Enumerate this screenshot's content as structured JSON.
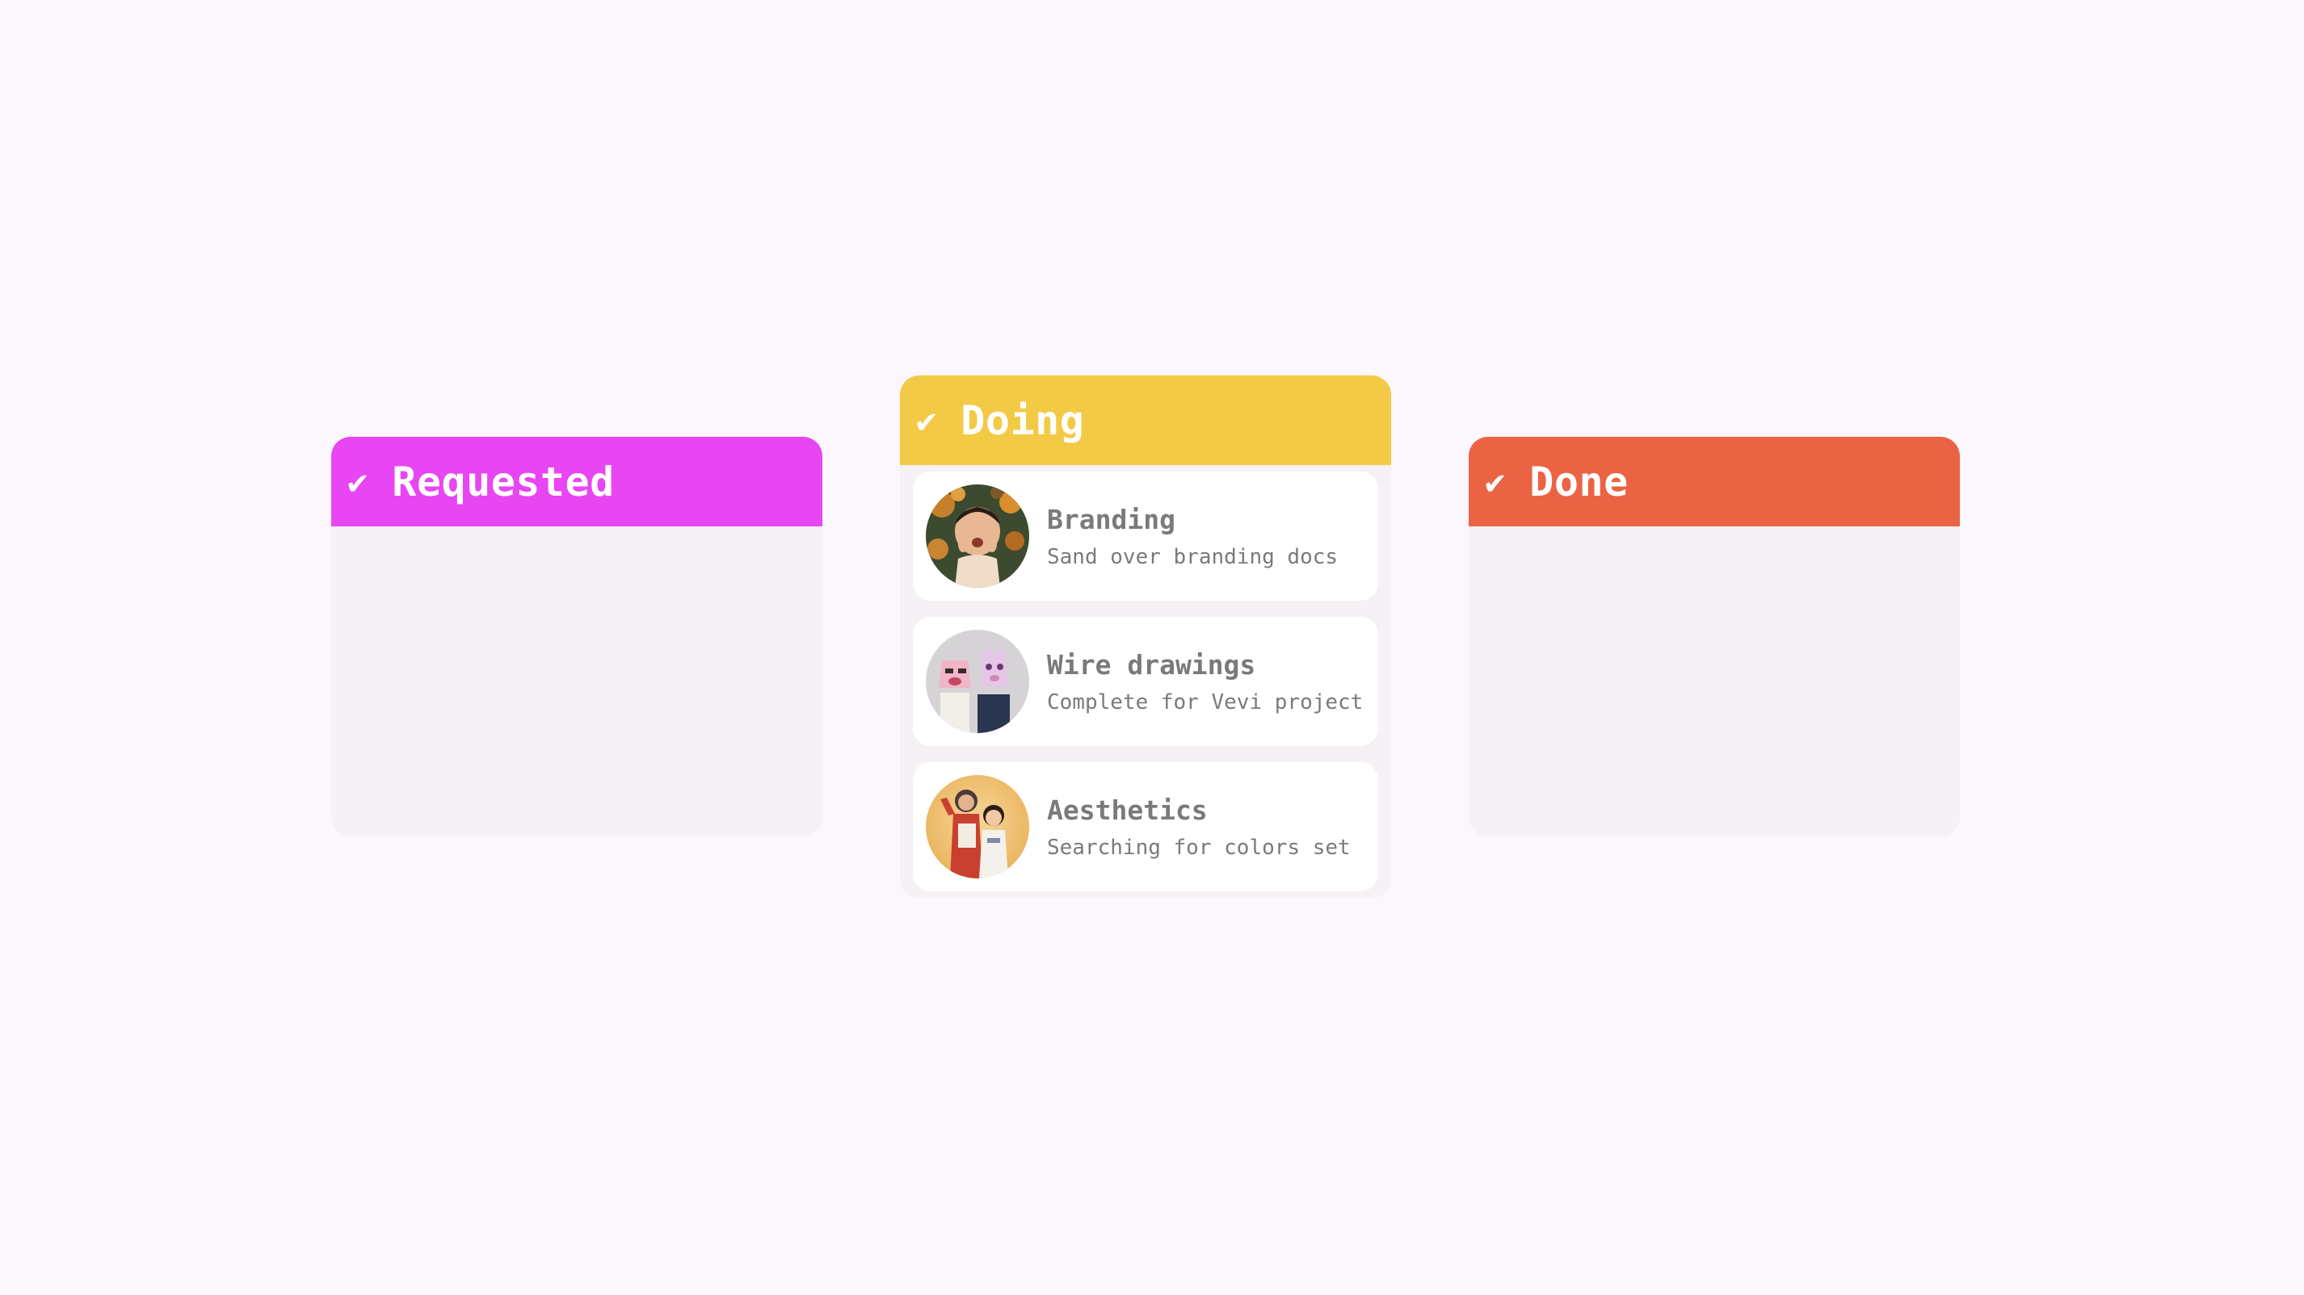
{
  "colors": {
    "background": "#fcf7fc",
    "column_body": "#f5f1f5",
    "requested": "#e845f3",
    "doing": "#f3ca45",
    "done": "#ea6444",
    "card_text": "#7a7a7a"
  },
  "columns": [
    {
      "id": "requested",
      "check_icon": "✔",
      "title": "Requested",
      "cards": []
    },
    {
      "id": "doing",
      "check_icon": "✔",
      "title": "Doing",
      "cards": [
        {
          "title": "Branding",
          "description": "Sand over branding docs",
          "avatar": "child-with-flowers-photo"
        },
        {
          "title": "Wire drawings",
          "description": "Complete for Vevi project",
          "avatar": "kids-with-masks-photo"
        },
        {
          "title": "Aesthetics",
          "description": "Searching for colors set",
          "avatar": "kids-in-costumes-photo"
        }
      ]
    },
    {
      "id": "done",
      "check_icon": "✔",
      "title": "Done",
      "cards": []
    }
  ]
}
